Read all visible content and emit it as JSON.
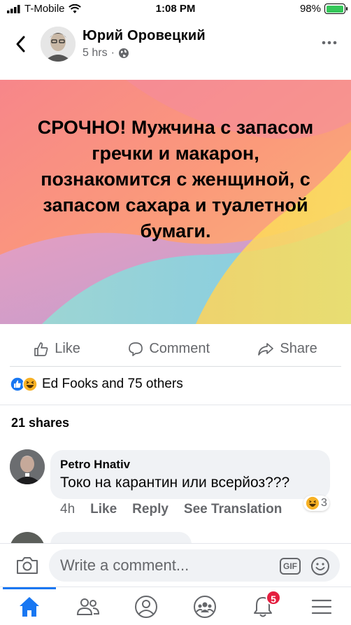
{
  "status_bar": {
    "carrier": "T-Mobile",
    "time": "1:08 PM",
    "battery": "98%",
    "battery_level": 0.98
  },
  "post": {
    "author": "Юрий Оровецкий",
    "time": "5 hrs",
    "separator": "·",
    "image_text": "СРОЧНО! Мужчина с запасом гречки и макарон, познакомится с женщиной, с запасом сахара и туалетной бумаги.",
    "actions": {
      "like": "Like",
      "comment": "Comment",
      "share": "Share"
    },
    "reactions_text": "Ed Fooks and 75 others",
    "shares_text": "21 shares"
  },
  "comment": {
    "author": "Petro Hnativ",
    "body": "Токо на карантин или всерйоз???",
    "time": "4h",
    "like": "Like",
    "reply": "Reply",
    "translate": "See Translation",
    "reaction_count": "3"
  },
  "composer": {
    "placeholder": "Write a comment...",
    "gif_label": "GIF"
  },
  "tabbar": {
    "notifications_badge": "5",
    "active_tab": "home"
  },
  "colors": {
    "brand": "#1877f2",
    "secondary_text": "#65676b",
    "badge": "#e41e3f"
  }
}
